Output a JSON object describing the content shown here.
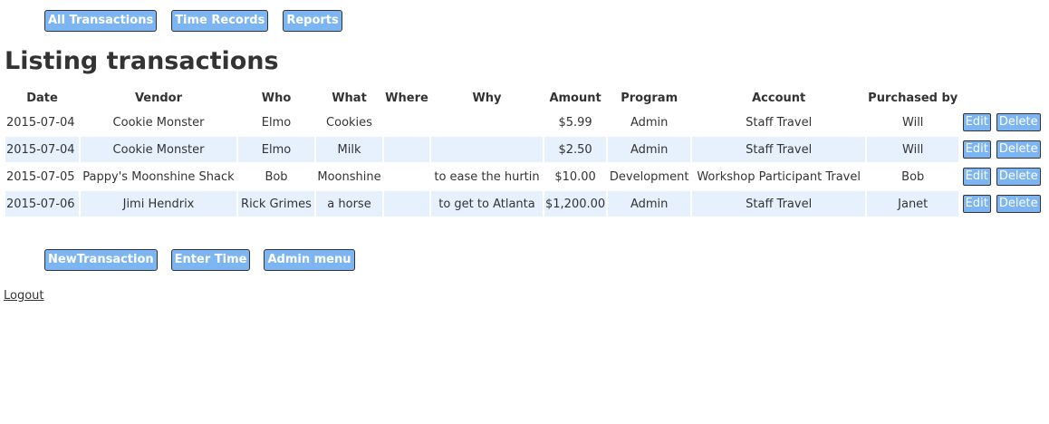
{
  "nav_top": [
    {
      "label": "All Transactions"
    },
    {
      "label": "Time Records"
    },
    {
      "label": "Reports"
    }
  ],
  "page_title": "Listing transactions",
  "table": {
    "columns": [
      "Date",
      "Vendor",
      "Who",
      "What",
      "Where",
      "Why",
      "Amount",
      "Program",
      "Account",
      "Purchased by"
    ],
    "rows": [
      {
        "date": "2015-07-04",
        "vendor": "Cookie Monster",
        "who": "Elmo",
        "what": "Cookies",
        "where": "",
        "why": "",
        "amount": "$5.99",
        "program": "Admin",
        "account": "Staff Travel",
        "purchased_by": "Will"
      },
      {
        "date": "2015-07-04",
        "vendor": "Cookie Monster",
        "who": "Elmo",
        "what": "Milk",
        "where": "",
        "why": "",
        "amount": "$2.50",
        "program": "Admin",
        "account": "Staff Travel",
        "purchased_by": "Will"
      },
      {
        "date": "2015-07-05",
        "vendor": "Pappy's Moonshine Shack",
        "who": "Bob",
        "what": "Moonshine",
        "where": "",
        "why": "to ease the hurtin",
        "amount": "$10.00",
        "program": "Development",
        "account": "Workshop Participant Travel",
        "purchased_by": "Bob"
      },
      {
        "date": "2015-07-06",
        "vendor": "Jimi Hendrix",
        "who": "Rick Grimes",
        "what": "a horse",
        "where": "",
        "why": "to get to Atlanta",
        "amount": "$1,200.00",
        "program": "Admin",
        "account": "Staff Travel",
        "purchased_by": "Janet"
      }
    ],
    "edit_label": "Edit",
    "delete_label": "Delete"
  },
  "nav_bottom": [
    {
      "label": "NewTransaction"
    },
    {
      "label": "Enter Time"
    },
    {
      "label": "Admin menu"
    }
  ],
  "logout_label": "Logout",
  "colors": {
    "button_bg": "#7cb5f2",
    "alt_row_bg": "#e6f1fd",
    "text": "#333333"
  }
}
